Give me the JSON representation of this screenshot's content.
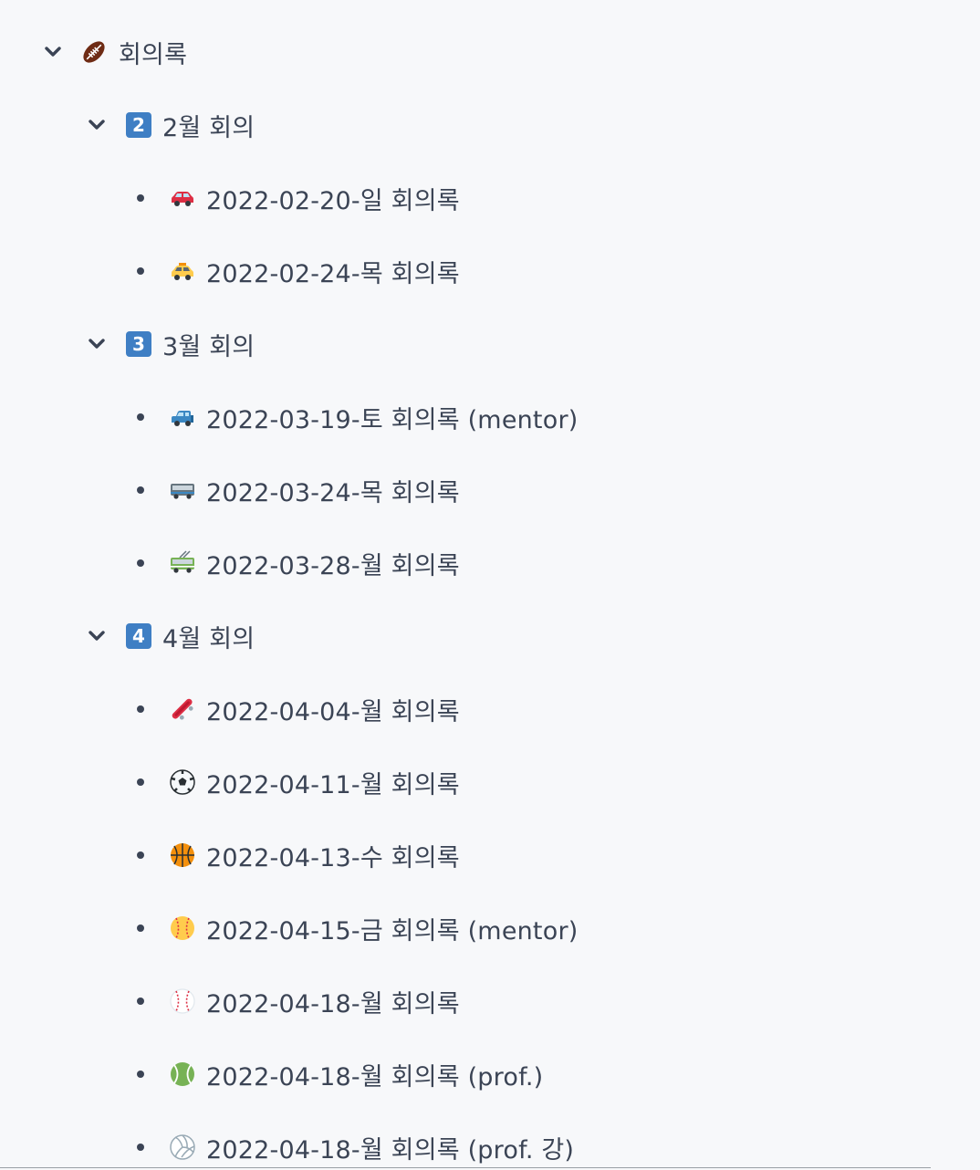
{
  "root": {
    "label": "회의록",
    "icon": "american-football-icon",
    "expanded": true
  },
  "groups": [
    {
      "keycap": "2",
      "label": "2월 회의",
      "expanded": true,
      "items": [
        {
          "label": "2022-02-20-일 회의록",
          "icon": "red-car-icon"
        },
        {
          "label": "2022-02-24-목 회의록",
          "icon": "taxi-icon"
        }
      ]
    },
    {
      "keycap": "3",
      "label": "3월 회의",
      "expanded": true,
      "items": [
        {
          "label": "2022-03-19-토 회의록 (mentor)",
          "icon": "blue-car-icon"
        },
        {
          "label": "2022-03-24-목 회의록",
          "icon": "bus-icon"
        },
        {
          "label": "2022-03-28-월 회의록",
          "icon": "trolleybus-icon"
        }
      ]
    },
    {
      "keycap": "4",
      "label": "4월 회의",
      "expanded": true,
      "items": [
        {
          "label": "2022-04-04-월 회의록",
          "icon": "skateboard-icon"
        },
        {
          "label": "2022-04-11-월 회의록",
          "icon": "soccer-ball-icon"
        },
        {
          "label": "2022-04-13-수 회의록",
          "icon": "basketball-icon"
        },
        {
          "label": "2022-04-15-금 회의록 (mentor)",
          "icon": "softball-icon"
        },
        {
          "label": "2022-04-18-월 회의록",
          "icon": "baseball-icon"
        },
        {
          "label": "2022-04-18-월 회의록 (prof.)",
          "icon": "tennis-ball-icon"
        },
        {
          "label": "2022-04-18-월 회의록 (prof. 강)",
          "icon": "volleyball-icon"
        }
      ]
    }
  ],
  "colors": {
    "background": "#f7f8fa",
    "text": "#3b4455",
    "keycap": "#3f7fc4"
  }
}
